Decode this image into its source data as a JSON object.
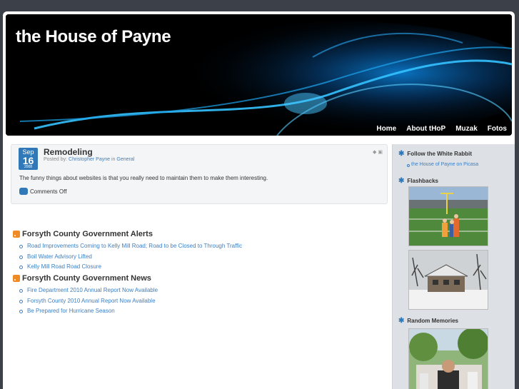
{
  "site": {
    "title": "the House of Payne",
    "nav": [
      "Home",
      "About tHoP",
      "Muzak",
      "Fotos"
    ]
  },
  "post": {
    "title": "Remodeling",
    "date": {
      "month": "Sep",
      "day": "16",
      "year": "2008"
    },
    "meta_prefix": "Posted by:",
    "author": "Christopher Payne",
    "in_label": "in",
    "category": "General",
    "body": "The funny things about websites is that you really need to maintain them to make them interesting.",
    "comments": "Comments Off"
  },
  "feeds": [
    {
      "title": "Forsyth County Government Alerts",
      "items": [
        "Road Improvements Coming to Kelly Mill Road; Road to be Closed to Through Traffic",
        "Boil Water Advisory Lifted",
        "Kelly Mill Road Road Closure"
      ]
    },
    {
      "title": "Forsyth County Government News",
      "items": [
        "Fire Department 2010 Annual Report Now Available",
        "Forsyth County 2010 Annual Report Now Available",
        "Be Prepared for Hurricane Season"
      ]
    }
  ],
  "sidebar": {
    "follow_title": "Follow the White Rabbit",
    "follow_link": "the House of Payne on Picasa",
    "flashbacks_title": "Flashbacks",
    "random_title": "Random Memories"
  },
  "colors": {
    "accent": "#2f79b8",
    "link": "#3b7fc4",
    "rss": "#f08a24"
  }
}
